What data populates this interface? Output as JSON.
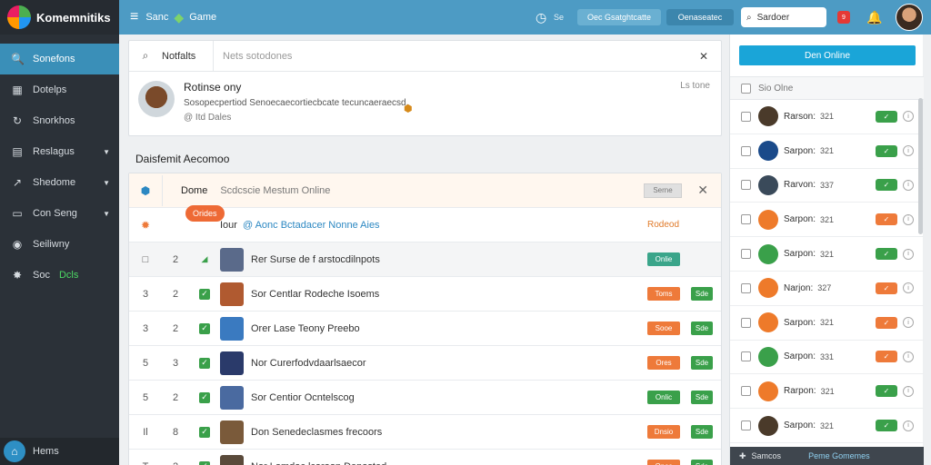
{
  "app": {
    "name": "Komemnitiks"
  },
  "sidebar": {
    "items": [
      {
        "icon": "search-icon",
        "glyph": "🔍",
        "label": "Sonefons"
      },
      {
        "icon": "calendar-icon",
        "glyph": "▦",
        "label": "Dotelps"
      },
      {
        "icon": "refresh-icon",
        "glyph": "↻",
        "label": "Snorkhos"
      },
      {
        "icon": "doc-icon",
        "glyph": "▤",
        "label": "Reslagus"
      },
      {
        "icon": "chart-icon",
        "glyph": "↗",
        "label": "Shedome"
      },
      {
        "icon": "card-icon",
        "glyph": "▭",
        "label": "Con Seng"
      },
      {
        "icon": "globe-icon",
        "glyph": "◉",
        "label": "Seiliwny"
      },
      {
        "icon": "bug-icon",
        "glyph": "✸",
        "label": "Soc",
        "extra": "Dcls"
      }
    ],
    "footer": {
      "label": "Hems"
    }
  },
  "topbar": {
    "crumb1": "Sanc",
    "crumb2": "Game",
    "clock_label": "Se",
    "pill1": "Oec Gsatghtcatte",
    "pill2": "Oenaseatec",
    "search_placeholder": "Sardoer",
    "notif_count": "9"
  },
  "notice": {
    "label": "Notfalts",
    "placeholder": "Nets sotodones",
    "title": "Rotinse ony",
    "text": "Sosopecpertiod Senoecaecortiecbcate tecuncaeraecsd.",
    "meta": "@ Itd Dales",
    "time": "Ls tone"
  },
  "section_title": "Daisfemit Aecomoo",
  "table": {
    "header1": {
      "title": "Dome",
      "subtitle": "Scdcscie Mestum Online",
      "button": "Serne"
    },
    "header2": {
      "tag": "Orides",
      "t1": "Iour",
      "t2": "@ Aonc Bctadacer Nonne Aies",
      "status": "Rodeod"
    },
    "rows": [
      {
        "c1": "□",
        "c2": "2",
        "check": "plain",
        "title": "Rer Surse de f arstocdilnpots",
        "thumbColor": "#5a6a8a",
        "badges": [
          {
            "text": "Onlie",
            "color": "teal",
            "pos": 570
          }
        ],
        "grey": true
      },
      {
        "c1": "3",
        "c2": "2",
        "check": "box",
        "title": "Sor Centlar Rodeche Isoems",
        "thumbColor": "#b05a30",
        "badges": [
          {
            "text": "Toms",
            "color": "orange",
            "pos": 570
          },
          {
            "text": "Sde",
            "color": "green",
            "pos": 618
          }
        ]
      },
      {
        "c1": "3",
        "c2": "2",
        "check": "box",
        "title": "Orer Lase Teony Preebo",
        "thumbColor": "#3a7ac0",
        "badges": [
          {
            "text": "Sooe",
            "color": "orange",
            "pos": 570
          },
          {
            "text": "Sde",
            "color": "green",
            "pos": 618
          }
        ]
      },
      {
        "c1": "5",
        "c2": "3",
        "check": "box",
        "title": "Nor Curerfodvdaarlsaecor",
        "thumbColor": "#2a3a6a",
        "badges": [
          {
            "text": "Ores",
            "color": "orange",
            "pos": 570
          },
          {
            "text": "Sde",
            "color": "green",
            "pos": 618
          }
        ]
      },
      {
        "c1": "5",
        "c2": "2",
        "check": "box",
        "title": "Sor Centior Ocntelscog",
        "thumbColor": "#4a6aa0",
        "badges": [
          {
            "text": "Onlic",
            "color": "green",
            "pos": 570
          },
          {
            "text": "Sde",
            "color": "green",
            "pos": 618
          }
        ]
      },
      {
        "c1": "Il",
        "c2": "8",
        "check": "box",
        "title": "Don Senedeclasmes frecoors",
        "thumbColor": "#7a5a3a",
        "badges": [
          {
            "text": "Dnsio",
            "color": "orange",
            "pos": 570
          },
          {
            "text": "Sde",
            "color": "green",
            "pos": 618
          }
        ]
      },
      {
        "c1": "T",
        "c2": "2",
        "check": "box",
        "title": "Nar Lomdac lcaraon Deposted",
        "thumbColor": "#5a4a3a",
        "badges": [
          {
            "text": "Ones",
            "color": "orange",
            "pos": 570
          },
          {
            "text": "Sde",
            "color": "green",
            "pos": 618
          }
        ]
      }
    ]
  },
  "right": {
    "button": "Den Online",
    "filter": "Sio Olne",
    "players": [
      {
        "name": "Rarson:",
        "num": "321",
        "ava": "#4a3a2a",
        "toggle": "green"
      },
      {
        "name": "Sarpon:",
        "num": "321",
        "ava": "#1a4a8a",
        "toggle": "green"
      },
      {
        "name": "Rarvon:",
        "num": "337",
        "ava": "#3a4a5a",
        "toggle": "green"
      },
      {
        "name": "Sarpon:",
        "num": "321",
        "ava": "#ee7a2a",
        "toggle": "orange"
      },
      {
        "name": "Sarpon:",
        "num": "321",
        "ava": "#3aa04a",
        "toggle": "green"
      },
      {
        "name": "Narjon:",
        "num": "327",
        "ava": "#ee7a2a",
        "toggle": "orange"
      },
      {
        "name": "Sarpon:",
        "num": "321",
        "ava": "#ee7a2a",
        "toggle": "orange"
      },
      {
        "name": "Sarpon:",
        "num": "331",
        "ava": "#3aa04a",
        "toggle": "orange"
      },
      {
        "name": "Rarpon:",
        "num": "321",
        "ava": "#ee7a2a",
        "toggle": "green"
      },
      {
        "name": "Sarpon:",
        "num": "321",
        "ava": "#4a3a2a",
        "toggle": "green"
      }
    ],
    "footer1": "Samcos",
    "footer2": "Peme Gomemes"
  }
}
